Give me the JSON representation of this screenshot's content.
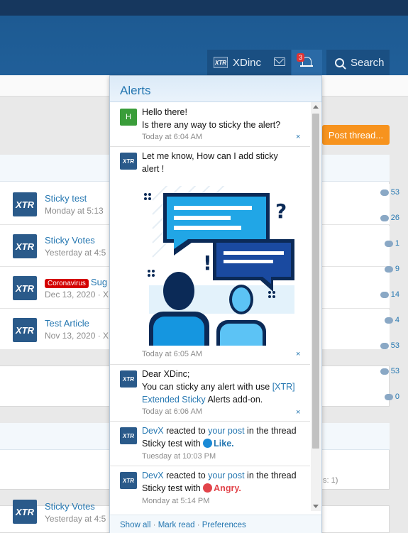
{
  "header": {
    "username": "XDinc",
    "alerts_badge": "3",
    "search_label": "Search",
    "logo_text": "XTR"
  },
  "post_thread_label": "Post thread...",
  "threads": [
    {
      "title": "Sticky test",
      "meta": "Monday at 5:13",
      "stat": "53"
    },
    {
      "title": "Sticky Votes",
      "meta": "Yesterday at 4:5",
      "stat": "26"
    },
    {
      "prefix": "Coronavirus",
      "title": "Sug",
      "meta": "Dec 13, 2020 · X",
      "stat": "1"
    },
    {
      "title": "Test Article",
      "meta": "Nov 13, 2020 · X",
      "stat": "9"
    }
  ],
  "stats_more": [
    "14",
    "4",
    "53",
    "53",
    "0"
  ],
  "bottom_thread": {
    "title": "Sticky Votes",
    "meta": "Yesterday at 4:5"
  },
  "bottom_fragment": "s: 1)",
  "alerts": {
    "title": "Alerts",
    "items": [
      {
        "avatar": "H",
        "text1": "Hello there!",
        "text2": "Is there any way to sticky the alert?",
        "time": "Today at 6:04 AM"
      },
      {
        "avatar": "XTR",
        "text1": "Let me know, How can I add sticky",
        "text2": "alert !",
        "time": "Today at 6:05 AM"
      },
      {
        "avatar": "XTR",
        "text1": "Dear XDinc;",
        "text2": "You can sticky any alert with use",
        "link": "[XTR] Extended Sticky",
        "text3": "Alerts add-on.",
        "time": "Today at 6:06 AM"
      },
      {
        "avatar": "XTR",
        "user": "DevX",
        "mid": "reacted to",
        "post": "your post",
        "end": "in the thread Sticky test with",
        "reaction": "Like.",
        "time": "Tuesday at 10:03 PM"
      },
      {
        "avatar": "XTR",
        "user": "DevX",
        "mid": "reacted to",
        "post": "your post",
        "end": "in the thread Sticky test with",
        "reaction": "Angry.",
        "time": "Monday at 5:14 PM"
      }
    ],
    "footer": {
      "show_all": "Show all",
      "sep": "·",
      "mark_read": "Mark read",
      "preferences": "Preferences"
    },
    "dismiss": "×"
  },
  "colors": {
    "accent": "#2577b1",
    "header": "#1d5a92",
    "button": "#f7931e"
  }
}
